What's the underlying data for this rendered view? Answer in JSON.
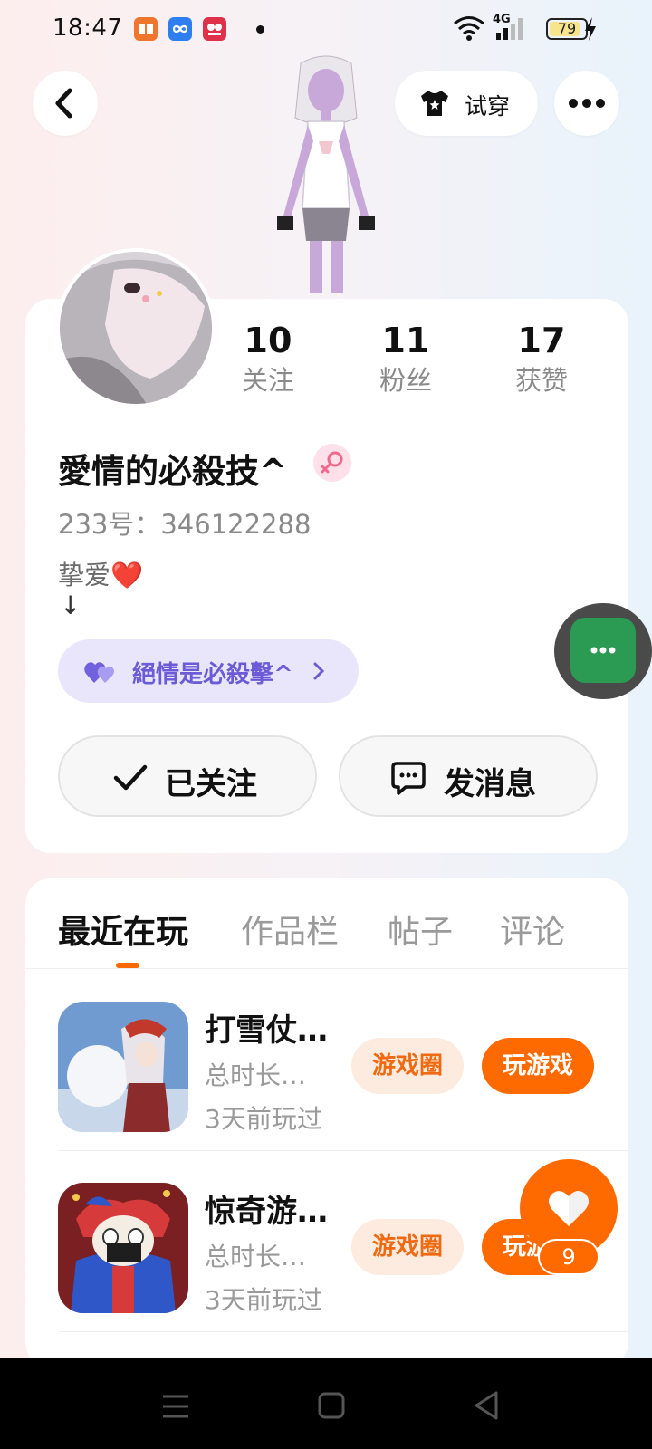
{
  "status_bar": {
    "time": "18:47",
    "network": "4G",
    "battery_level": "79",
    "app_icons": [
      "book-app-icon",
      "infinity-app-icon",
      "233-app-icon"
    ]
  },
  "header": {
    "try_on_label": "试穿"
  },
  "profile": {
    "stats": [
      {
        "value": "10",
        "label": "关注"
      },
      {
        "value": "11",
        "label": "粉丝"
      },
      {
        "value": "17",
        "label": "获赞"
      }
    ],
    "nickname": "愛情的必殺技^",
    "account_id": "233号：346122288",
    "bio_line1": "挚爱❤️",
    "bio_line2": "↓",
    "cp_tag": "絕情是必殺擊^",
    "follow_label": "已关注",
    "message_label": "发消息"
  },
  "tabs": [
    {
      "label": "最近在玩",
      "active": true
    },
    {
      "label": "作品栏",
      "active": false
    },
    {
      "label": "帖子",
      "active": false
    },
    {
      "label": "评论",
      "active": false
    }
  ],
  "games": [
    {
      "title": "打雪仗…",
      "duration": "总时长…",
      "last_played": "3天前玩过",
      "circle_label": "游戏圈",
      "play_label": "玩游戏"
    },
    {
      "title": "惊奇游…",
      "duration": "总时长…",
      "last_played": "3天前玩过",
      "circle_label": "游戏圈",
      "play_label": "玩游戏"
    }
  ],
  "like_count": "9",
  "colors": {
    "accent": "#ff6a00",
    "cp_tag_bg": "#e9e6fb",
    "cp_tag_text": "#6b5bd6",
    "float_chat": "#2b9a52"
  }
}
